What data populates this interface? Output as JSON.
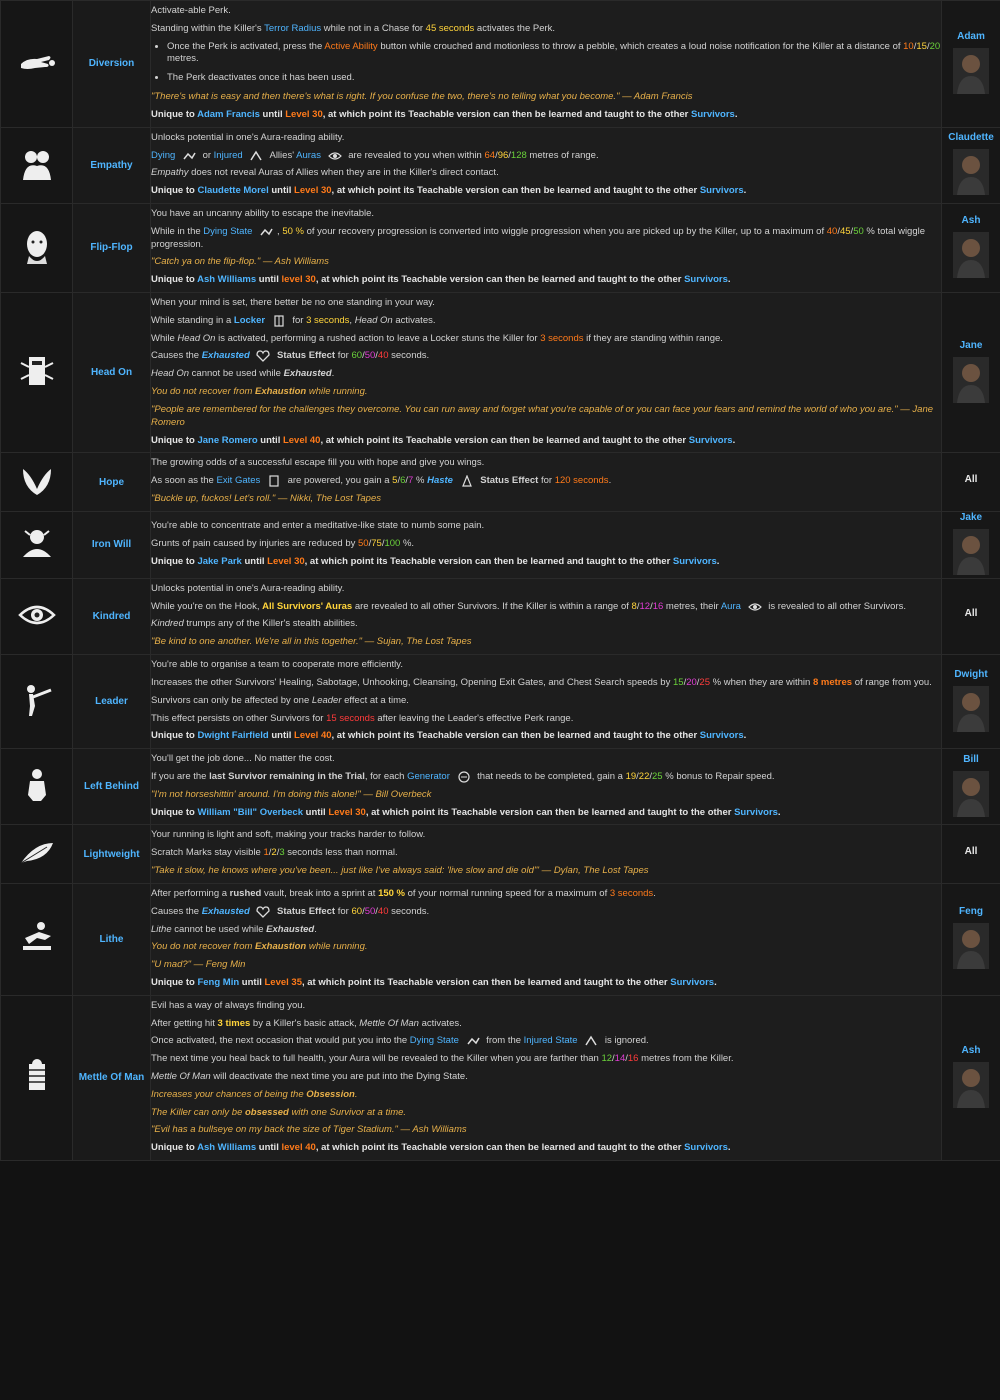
{
  "perks": [
    {
      "name": "Diversion",
      "icon": "hand-pebble-icon",
      "character": "Adam",
      "portrait": "adam-francis-portrait",
      "lines": [
        {
          "t": "Activate-able Perk."
        },
        {
          "t": "Standing within the Killer's {b:Terror Radius} while not in a Chase for {y:45 seconds} activates the Perk."
        },
        {
          "li": "Once the Perk is activated, press the {o:Active Ability} button while crouched and motionless to throw a pebble, which creates a loud noise notification for the Killer at a distance of {o:10}/{y:15}/{g:20} metres."
        },
        {
          "li": "The Perk deactivates once it has been used."
        },
        {
          "q": "\"There's what is easy and then there's what is right. If you confuse the two, there's no telling what you become.\" — Adam Francis"
        },
        {
          "u": "Unique to {b:Adam Francis} until {o:Level 30}, at which point its Teachable version can then be learned and taught to the other {b:Survivors}."
        }
      ]
    },
    {
      "name": "Empathy",
      "icon": "empathy-hug-icon",
      "character": "Claudette",
      "portrait": "claudette-morel-portrait",
      "lines": [
        {
          "t": "Unlocks potential in one's Aura-reading ability."
        },
        {
          "t": "{b:Dying} [dying-state-icon] or {b:Injured} [injured-state-icon] Allies' {b:Auras} [aura-icon] are revealed to you when within {o:64}/{y:96}/{g:128} metres of range."
        },
        {
          "t": "{i:Empathy} does not reveal Auras of Allies when they are in the Killer's direct contact."
        },
        {
          "u": "Unique to {b:Claudette Morel} until {o:Level 30}, at which point its Teachable version can then be learned and taught to the other {b:Survivors}."
        }
      ]
    },
    {
      "name": "Flip-Flop",
      "icon": "flip-flop-face-icon",
      "character": "Ash",
      "portrait": "ash-williams-portrait",
      "lines": [
        {
          "t": "You have an uncanny ability to escape the inevitable."
        },
        {
          "t": "While in the {b:Dying State} [dying-state-icon], {y:50 %} of your recovery progression is converted into wiggle progression when you are picked up by the Killer, up to a maximum of {o:40}/{y:45}/{g:50} % total wiggle progression."
        },
        {
          "q": "\"Catch ya on the flip-flop.\" — Ash Williams"
        },
        {
          "u": "Unique to {b:Ash Williams} until {o:level 30}, at which point its Teachable version can then be learned and taught to the other {b:Survivors}."
        }
      ]
    },
    {
      "name": "Head On",
      "icon": "locker-burst-icon",
      "character": "Jane",
      "portrait": "jane-romero-portrait",
      "lines": [
        {
          "t": "When your mind is set, there better be no one standing in your way."
        },
        {
          "t": "While standing in a {bb:Locker} [locker-icon] for {y:3 seconds}, {i:Head On} activates."
        },
        {
          "t": "While {i:Head On} is activated, performing a rushed action to leave a Locker stuns the Killer for {o:3 seconds} if they are standing within range."
        },
        {
          "t": "Causes the {bi:Exhausted} [exhausted-heart-icon] {w:Status Effect} for {g:60}/{p:50}/{r:40} seconds."
        },
        {
          "t": "{i:Head On} cannot be used while {wi:Exhausted}."
        },
        {
          "q": "You do not recover from {wq:Exhaustion} while running."
        },
        {
          "q": "\"People are remembered for the challenges they overcome. You can run away and forget what you're capable of or you can face your fears and remind the world of who you are.\" — Jane Romero"
        },
        {
          "u": "Unique to {b:Jane Romero} until {o:Level 40}, at which point its Teachable version can then be learned and taught to the other {b:Survivors}."
        }
      ]
    },
    {
      "name": "Hope",
      "icon": "wings-icon",
      "character": "All",
      "portrait": "",
      "lines": [
        {
          "t": "The growing odds of a successful escape fill you with hope and give you wings."
        },
        {
          "t": "As soon as the {b:Exit Gates} [exit-gate-icon] are powered, you gain a {y:5}/{g:6}/{p:7} % {bi:Haste} [haste-icon] {w:Status Effect} for {o:120 seconds}."
        },
        {
          "q": "\"Buckle up, fuckos! Let's roll.\" — Nikki, The Lost Tapes"
        }
      ]
    },
    {
      "name": "Iron Will",
      "icon": "meditating-head-icon",
      "character": "Jake",
      "portrait": "jake-park-portrait",
      "lines": [
        {
          "t": "You're able to concentrate and enter a meditative-like state to numb some pain."
        },
        {
          "t": "Grunts of pain caused by injuries are reduced by {o:50}/{y:75}/{g:100} %."
        },
        {
          "u": "Unique to {b:Jake Park} until {o:Level 30}, at which point its Teachable version can then be learned and taught to the other {b:Survivors}."
        }
      ]
    },
    {
      "name": "Kindred",
      "icon": "eye-icon",
      "character": "All",
      "portrait": "",
      "lines": [
        {
          "t": "Unlocks potential in one's Aura-reading ability."
        },
        {
          "t": "While you're on the Hook, {yb:All Survivors' Auras} are revealed to all other Survivors. If the Killer is within a range of {y:8}/{p:12}/{p:16} metres, their {b:Aura} [aura-icon] is revealed to all other Survivors."
        },
        {
          "t": "{i:Kindred} trumps any of the Killer's stealth abilities."
        },
        {
          "q": "\"Be kind to one another. We're all in this together.\" — Sujan, The Lost Tapes"
        }
      ]
    },
    {
      "name": "Leader",
      "icon": "pointing-figure-icon",
      "character": "Dwight",
      "portrait": "dwight-fairfield-portrait",
      "lines": [
        {
          "t": "You're able to organise a team to cooperate more efficiently."
        },
        {
          "t": "Increases the other Survivors' Healing, Sabotage, Unhooking, Cleansing, Opening Exit Gates, and Chest Search speeds by {g:15}/{p:20}/{r:25} % when they are within {ob:8 metres} of range from you."
        },
        {
          "t": "Survivors can only be affected by one {i:Leader} effect at a time."
        },
        {
          "t": "This effect persists on other Survivors for {r:15 seconds} after leaving the Leader's effective Perk range."
        },
        {
          "u": "Unique to {b:Dwight Fairfield} until {o:Level 40}, at which point its Teachable version can then be learned and taught to the other {b:Survivors}."
        }
      ]
    },
    {
      "name": "Left Behind",
      "icon": "seated-figure-icon",
      "character": "Bill",
      "portrait": "bill-overbeck-portrait",
      "lines": [
        {
          "t": "You'll get the job done... No matter the cost."
        },
        {
          "t": "If you are the {wb:last Survivor remaining in the Trial}, for each {b:Generator} [generator-icon] that needs to be completed, gain a {y:19}/{y:22}/{g:25} % bonus to Repair speed."
        },
        {
          "q": "\"I'm not horseshittin' around. I'm doing this alone!\" — Bill Overbeck"
        },
        {
          "u": "Unique to {b:William \"Bill\" Overbeck} until {o:Level 30}, at which point its Teachable version can then be learned and taught to the other {b:Survivors}."
        }
      ]
    },
    {
      "name": "Lightweight",
      "icon": "feather-icon",
      "character": "All",
      "portrait": "",
      "lines": [
        {
          "t": "Your running is light and soft, making your tracks harder to follow."
        },
        {
          "t": "Scratch Marks stay visible {o:1}/{y:2}/{g:3} seconds less than normal."
        },
        {
          "q": "\"Take it slow, he knows where you've been... just like I've always said: 'live slow and die old'\" — Dylan, The Lost Tapes"
        }
      ]
    },
    {
      "name": "Lithe",
      "icon": "vaulting-figure-icon",
      "character": "Feng",
      "portrait": "feng-min-portrait",
      "lines": [
        {
          "t": "After performing a {wb:rushed} vault, break into a sprint at {yb:150 %} of your normal running speed for a maximum of {o:3 seconds}."
        },
        {
          "t": "Causes the {bi:Exhausted} [exhausted-heart-icon] {w:Status Effect} for {y:60}/{p:50}/{r:40} seconds."
        },
        {
          "t": "{i:Lithe} cannot be used while {wi:Exhausted}."
        },
        {
          "q": "You do not recover from {wq:Exhaustion} while running."
        },
        {
          "q": "\"U mad?\" — Feng Min"
        },
        {
          "u": "Unique to {b:Feng Min} until {o:Level 35}, at which point its Teachable version can then be learned and taught to the other {b:Survivors}."
        }
      ]
    },
    {
      "name": "Mettle Of Man",
      "icon": "pillar-figure-icon",
      "character": "Ash",
      "portrait": "ash-williams-portrait",
      "lines": [
        {
          "t": "Evil has a way of always finding you."
        },
        {
          "t": "After getting hit {yb:3 times} by a Killer's basic attack, {i:Mettle Of Man} activates."
        },
        {
          "t": "Once activated, the next occasion that would put you into the {b:Dying State} [dying-state-icon] from the {b:Injured State} [injured-state-icon] is ignored."
        },
        {
          "t": "The next time you heal back to full health, your Aura will be revealed to the Killer when you are farther than {g:12}/{p:14}/{r:16} metres from the Killer."
        },
        {
          "t": "{i:Mettle Of Man} will deactivate the next time you are put into the Dying State."
        },
        {
          "q": "Increases your chances of being the {wq:Obsession}."
        },
        {
          "q": "The Killer can only be {wq:obsessed} with one Survivor at a time."
        },
        {
          "q": "\"Evil has a bullseye on my back the size of Tiger Stadium.\" — Ash Williams"
        },
        {
          "u": "Unique to {b:Ash Williams} until {o:level 40}, at which point its Teachable version can then be learned and taught to the other {b:Survivors}."
        }
      ]
    }
  ],
  "colors": {
    "blue": "#4fb5ff",
    "orange": "#ff7a1a",
    "yellow": "#ffd43b",
    "green": "#6ad13a",
    "pink": "#e03cd4",
    "red": "#ff3b3b",
    "quote": "#e7b04a"
  }
}
